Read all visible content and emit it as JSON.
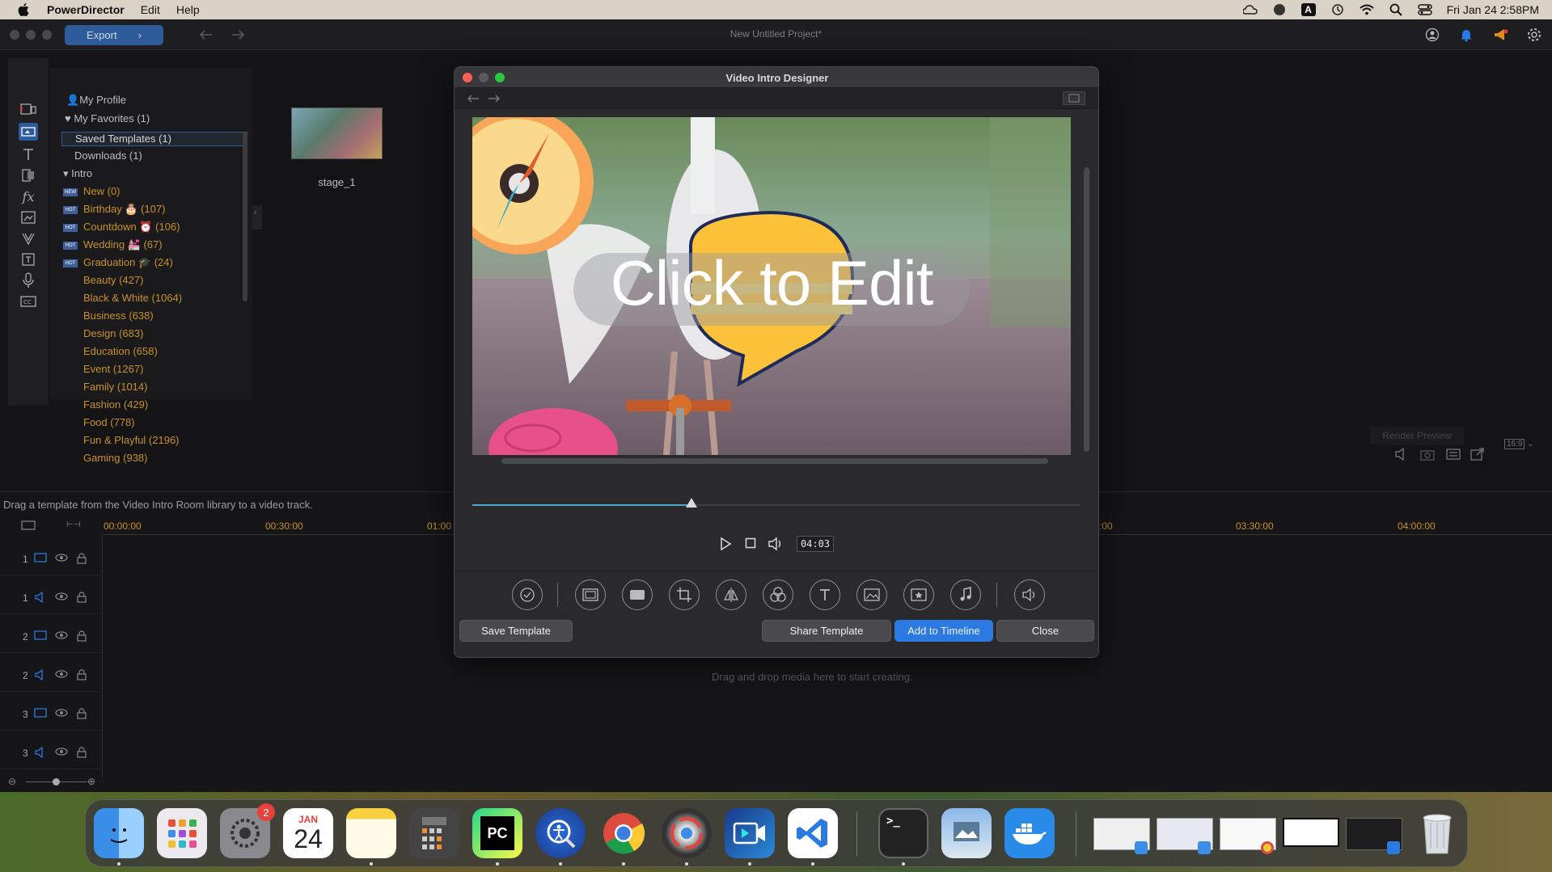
{
  "menubar": {
    "app_name": "PowerDirector",
    "menus": [
      "Edit",
      "Help"
    ],
    "keyboard_indicator": "A",
    "datetime": "Fri Jan 24  2:58PM"
  },
  "app": {
    "export_label": "Export",
    "project_title": "New Untitled Project*",
    "status_text": "Drag a template from the Video Intro Room library to a video track.",
    "drop_hint": "Drag and drop media here to start creating.",
    "render_preview": "Render Preview",
    "aspect_ratio": "16:9"
  },
  "library": {
    "my_profile": "My Profile",
    "my_favorites": "My Favorites (1)",
    "saved_templates": "Saved Templates (1)",
    "downloads": "Downloads (1)",
    "intro": "Intro",
    "new_badge": "NEW",
    "hot_badge": "HOT",
    "new_item": "New (0)",
    "hot_items": [
      "Birthday 🎂 (107)",
      "Countdown ⏰ (106)",
      "Wedding 💒 (67)",
      "Graduation 🎓 (24)"
    ],
    "categories": [
      "Beauty (427)",
      "Black & White (1064)",
      "Business (638)",
      "Design (683)",
      "Education (658)",
      "Event (1267)",
      "Family (1014)",
      "Fashion (429)",
      "Food (778)",
      "Fun & Playful (2196)",
      "Gaming (938)"
    ],
    "thumbnail_label": "stage_1"
  },
  "timeline": {
    "timecodes_left": [
      "00:00:00",
      "00:30:00",
      "01:00"
    ],
    "timecodes_right": [
      ":00",
      "03:30:00",
      "04:00:00"
    ],
    "tracks": [
      "1",
      "1",
      "2",
      "2",
      "3",
      "3"
    ]
  },
  "modal": {
    "title": "Video Intro Designer",
    "canvas_text": "Click to Edit",
    "timecode": "04:03",
    "seek_progress": 0.36,
    "buttons": {
      "save": "Save Template",
      "share": "Share Template",
      "add": "Add to Timeline",
      "close": "Close"
    }
  },
  "dock": {
    "calendar_month": "JAN",
    "calendar_day": "24",
    "settings_badge": "2",
    "pycharm_label": "PC"
  },
  "colors": {
    "accent_blue": "#2a7ae2",
    "category_orange": "#c8902a",
    "seek_blue": "#4aa7d4"
  }
}
